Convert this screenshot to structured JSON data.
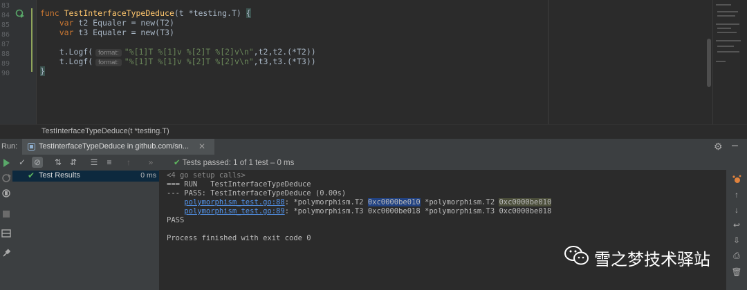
{
  "editor": {
    "line_numbers": [
      "83",
      "84",
      "85",
      "86",
      "87",
      "88",
      "89",
      "90"
    ],
    "lines": [
      {
        "kw": "func ",
        "fn": "TestInterfaceTypeDeduce",
        "rest": "(t *testing.T) ",
        "brace": "{"
      },
      {
        "indent": "    ",
        "kw": "var ",
        "rest": "t2 Equaler = new(T2)"
      },
      {
        "indent": "    ",
        "kw": "var ",
        "rest": "t3 Equaler = new(T3)"
      },
      {
        "text": ""
      },
      {
        "pre": "    t.Logf(",
        "hint": "format:",
        "str": "\"%[1]T %[1]v %[2]T %[2]v\\n\"",
        "post": ",t2,t2.(*T2))"
      },
      {
        "pre": "    t.Logf(",
        "hint": "format:",
        "str": "\"%[1]T %[1]v %[2]T %[2]v\\n\"",
        "post": ",t3,t3.(*T3))"
      },
      {
        "brace": "}"
      }
    ]
  },
  "breadcrumb": "TestInterfaceTypeDeduce(t *testing.T)",
  "run": {
    "label": "Run:",
    "tab_title": "TestInterfaceTypeDeduce in github.com/sn...",
    "status_prefix": "Tests passed:",
    "status_rest": " 1 of 1 test – 0 ms"
  },
  "tree": {
    "label": "Test Results",
    "time": "0 ms"
  },
  "console": {
    "setup": "<4 go setup calls>",
    "run_line": "=== RUN   TestInterfaceTypeDeduce",
    "pass_line": "--- PASS: TestInterfaceTypeDeduce (0.00s)",
    "log1": {
      "link": "polymorphism_test.go:88",
      "a": ": *polymorphism.T2 ",
      "b": "0xc0000be010",
      "c": " *polymorphism.T2 ",
      "d": "0xc0000be010"
    },
    "log2": {
      "link": "polymorphism_test.go:89",
      "a": ": *polymorphism.T3 ",
      "b": "0xc0000be018",
      "c": " *polymorphism.T3 ",
      "d": "0xc0000be018"
    },
    "pass": "PASS",
    "exit": "Process finished with exit code 0"
  },
  "watermark": "雪之梦技术驿站",
  "colors": {
    "pass_green": "#5fb85f",
    "link_blue": "#5394ec",
    "keyword": "#cc7832",
    "function": "#ffc66d",
    "string": "#6a8759"
  }
}
